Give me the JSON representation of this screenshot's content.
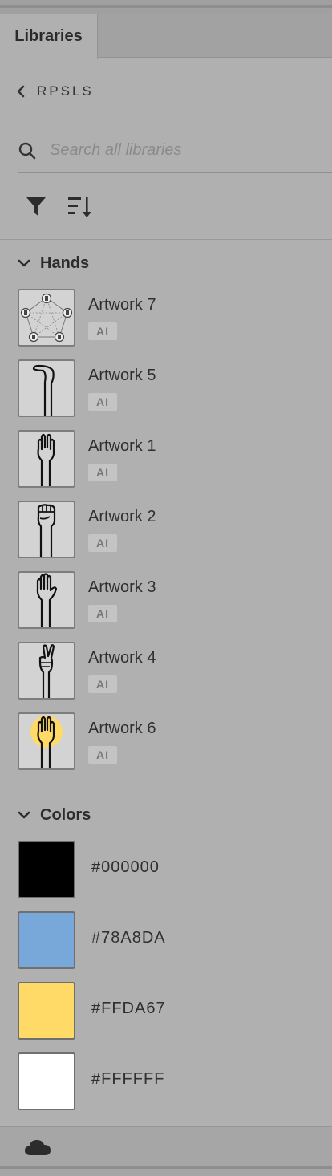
{
  "panel": {
    "tab_label": "Libraries"
  },
  "library": {
    "name": "RPSLS"
  },
  "search": {
    "placeholder": "Search all libraries",
    "value": ""
  },
  "toolbar": {
    "filter_icon": "filter-icon",
    "sort_icon": "sort-icon"
  },
  "sections": {
    "hands": {
      "title": "Hands",
      "items": [
        {
          "name": "Artwork 7",
          "badge": "AI",
          "thumb": "pentagon-diagram"
        },
        {
          "name": "Artwork 5",
          "badge": "AI",
          "thumb": "hand-lizard"
        },
        {
          "name": "Artwork 1",
          "badge": "AI",
          "thumb": "hand-spock"
        },
        {
          "name": "Artwork 2",
          "badge": "AI",
          "thumb": "hand-fist"
        },
        {
          "name": "Artwork 3",
          "badge": "AI",
          "thumb": "hand-open"
        },
        {
          "name": "Artwork 4",
          "badge": "AI",
          "thumb": "hand-scissors"
        },
        {
          "name": "Artwork 6",
          "badge": "AI",
          "thumb": "hand-spock-yellow"
        }
      ]
    },
    "colors": {
      "title": "Colors",
      "items": [
        {
          "hex": "#000000",
          "color": "#000000"
        },
        {
          "hex": "#78A8DA",
          "color": "#78A8DA"
        },
        {
          "hex": "#FFDA67",
          "color": "#FFDA67"
        },
        {
          "hex": "#FFFFFF",
          "color": "#FFFFFF"
        }
      ]
    }
  },
  "footer": {
    "icon": "creative-cloud-icon"
  }
}
